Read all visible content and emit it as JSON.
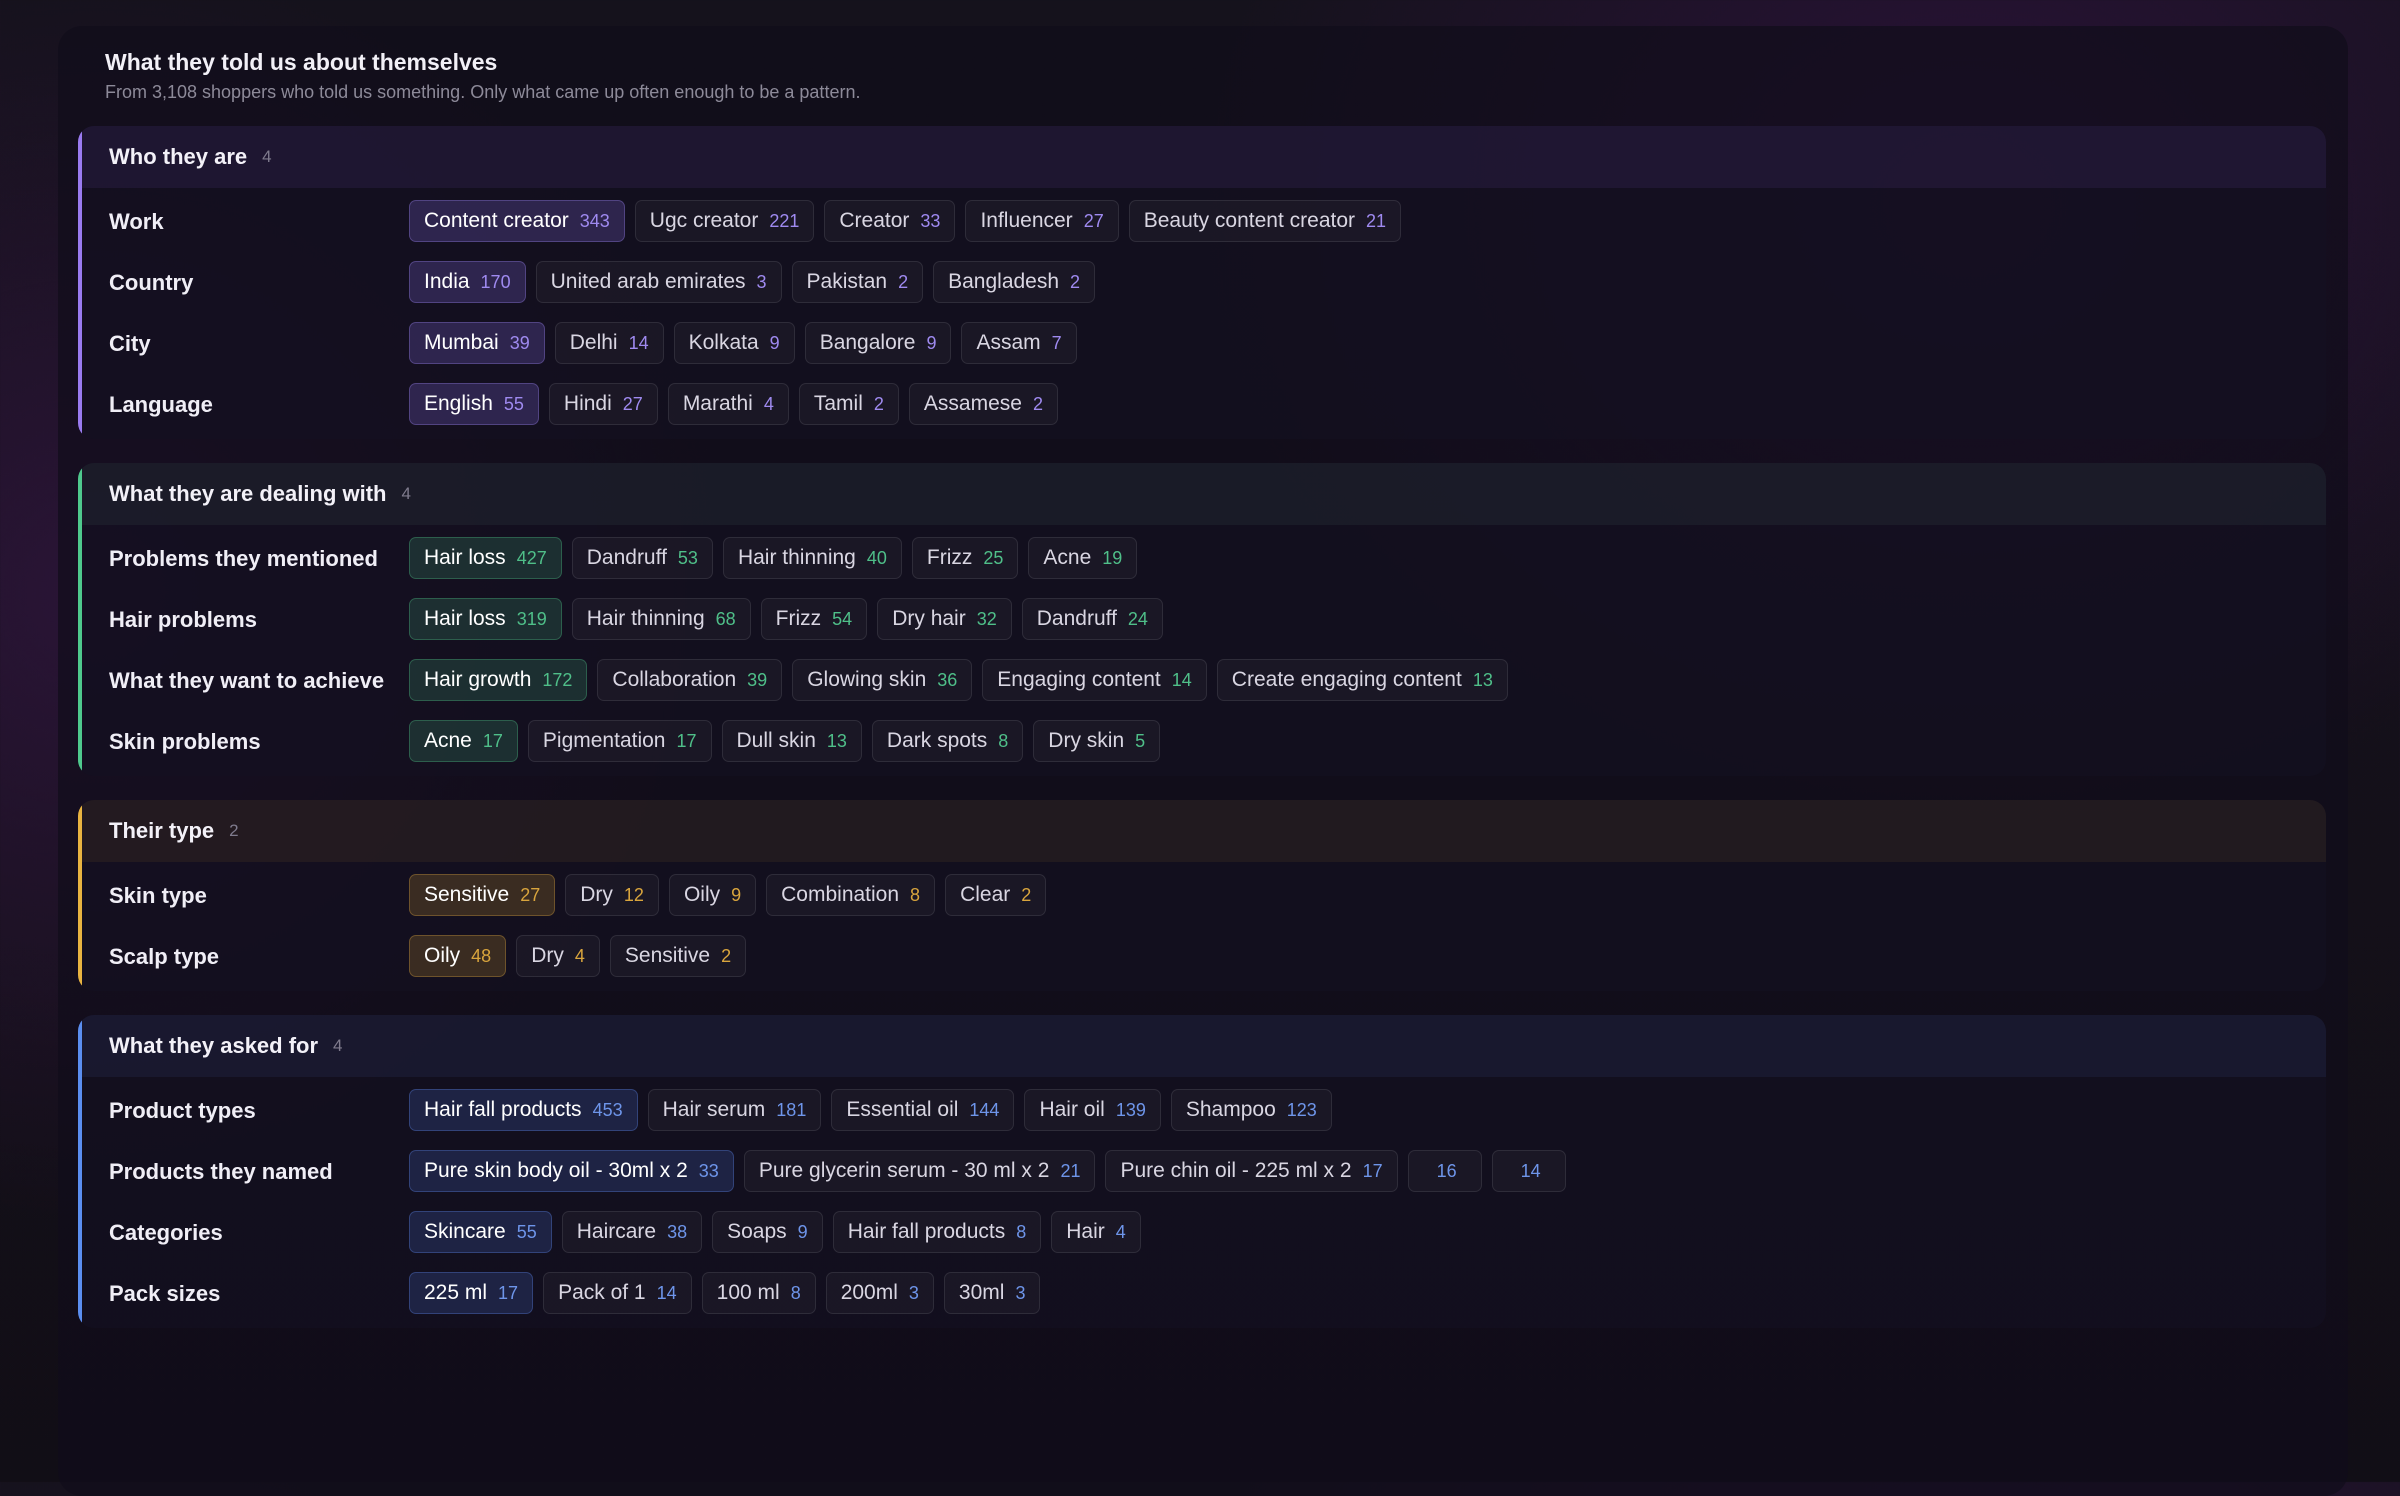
{
  "header": {
    "title": "What they told us about themselves",
    "subtitle": "From 3,108 shoppers who told us something. Only what came up often enough to be a pattern."
  },
  "colors": {
    "violet_accent": "#9a7bf0",
    "green_accent": "#4fc98d",
    "amber_accent": "#e9b441",
    "blue_accent": "#5b8ef0"
  },
  "sections": [
    {
      "title": "Who they are",
      "count": "4",
      "rows": [
        {
          "label": "Work",
          "chips": [
            {
              "label": "Content creator",
              "count": "343"
            },
            {
              "label": "Ugc creator",
              "count": "221"
            },
            {
              "label": "Creator",
              "count": "33"
            },
            {
              "label": "Influencer",
              "count": "27"
            },
            {
              "label": "Beauty content creator",
              "count": "21"
            }
          ]
        },
        {
          "label": "Country",
          "chips": [
            {
              "label": "India",
              "count": "170"
            },
            {
              "label": "United arab emirates",
              "count": "3"
            },
            {
              "label": "Pakistan",
              "count": "2"
            },
            {
              "label": "Bangladesh",
              "count": "2"
            }
          ]
        },
        {
          "label": "City",
          "chips": [
            {
              "label": "Mumbai",
              "count": "39"
            },
            {
              "label": "Delhi",
              "count": "14"
            },
            {
              "label": "Kolkata",
              "count": "9"
            },
            {
              "label": "Bangalore",
              "count": "9"
            },
            {
              "label": "Assam",
              "count": "7"
            }
          ]
        },
        {
          "label": "Language",
          "chips": [
            {
              "label": "English",
              "count": "55"
            },
            {
              "label": "Hindi",
              "count": "27"
            },
            {
              "label": "Marathi",
              "count": "4"
            },
            {
              "label": "Tamil",
              "count": "2"
            },
            {
              "label": "Assamese",
              "count": "2"
            }
          ]
        }
      ]
    },
    {
      "title": "What they are dealing with",
      "count": "4",
      "rows": [
        {
          "label": "Problems they mentioned",
          "chips": [
            {
              "label": "Hair loss",
              "count": "427"
            },
            {
              "label": "Dandruff",
              "count": "53"
            },
            {
              "label": "Hair thinning",
              "count": "40"
            },
            {
              "label": "Frizz",
              "count": "25"
            },
            {
              "label": "Acne",
              "count": "19"
            }
          ]
        },
        {
          "label": "Hair problems",
          "chips": [
            {
              "label": "Hair loss",
              "count": "319"
            },
            {
              "label": "Hair thinning",
              "count": "68"
            },
            {
              "label": "Frizz",
              "count": "54"
            },
            {
              "label": "Dry hair",
              "count": "32"
            },
            {
              "label": "Dandruff",
              "count": "24"
            }
          ]
        },
        {
          "label": "What they want to achieve",
          "chips": [
            {
              "label": "Hair growth",
              "count": "172"
            },
            {
              "label": "Collaboration",
              "count": "39"
            },
            {
              "label": "Glowing skin",
              "count": "36"
            },
            {
              "label": "Engaging content",
              "count": "14"
            },
            {
              "label": "Create engaging content",
              "count": "13"
            }
          ]
        },
        {
          "label": "Skin problems",
          "chips": [
            {
              "label": "Acne",
              "count": "17"
            },
            {
              "label": "Pigmentation",
              "count": "17"
            },
            {
              "label": "Dull skin",
              "count": "13"
            },
            {
              "label": "Dark spots",
              "count": "8"
            },
            {
              "label": "Dry skin",
              "count": "5"
            }
          ]
        }
      ]
    },
    {
      "title": "Their type",
      "count": "2",
      "rows": [
        {
          "label": "Skin type",
          "chips": [
            {
              "label": "Sensitive",
              "count": "27"
            },
            {
              "label": "Dry",
              "count": "12"
            },
            {
              "label": "Oily",
              "count": "9"
            },
            {
              "label": "Combination",
              "count": "8"
            },
            {
              "label": "Clear",
              "count": "2"
            }
          ]
        },
        {
          "label": "Scalp type",
          "chips": [
            {
              "label": "Oily",
              "count": "48"
            },
            {
              "label": "Dry",
              "count": "4"
            },
            {
              "label": "Sensitive",
              "count": "2"
            }
          ]
        }
      ]
    },
    {
      "title": "What they asked for",
      "count": "4",
      "rows": [
        {
          "label": "Product types",
          "chips": [
            {
              "label": "Hair fall products",
              "count": "453"
            },
            {
              "label": "Hair serum",
              "count": "181"
            },
            {
              "label": "Essential oil",
              "count": "144"
            },
            {
              "label": "Hair oil",
              "count": "139"
            },
            {
              "label": "Shampoo",
              "count": "123"
            }
          ]
        },
        {
          "label": "Products they named",
          "chips": [
            {
              "label": "Pure skin body oil - 30ml x 2",
              "count": "33"
            },
            {
              "label": "Pure glycerin serum - 30 ml x 2",
              "count": "21"
            },
            {
              "label": "Pure chin oil - 225 ml x 2",
              "count": "17"
            },
            {
              "label": "",
              "count": "16"
            },
            {
              "label": "",
              "count": "14"
            }
          ]
        },
        {
          "label": "Categories",
          "chips": [
            {
              "label": "Skincare",
              "count": "55"
            },
            {
              "label": "Haircare",
              "count": "38"
            },
            {
              "label": "Soaps",
              "count": "9"
            },
            {
              "label": "Hair fall products",
              "count": "8"
            },
            {
              "label": "Hair",
              "count": "4"
            }
          ]
        },
        {
          "label": "Pack sizes",
          "chips": [
            {
              "label": "225 ml",
              "count": "17"
            },
            {
              "label": "Pack of 1",
              "count": "14"
            },
            {
              "label": "100 ml",
              "count": "8"
            },
            {
              "label": "200ml",
              "count": "3"
            },
            {
              "label": "30ml",
              "count": "3"
            }
          ]
        }
      ]
    }
  ]
}
